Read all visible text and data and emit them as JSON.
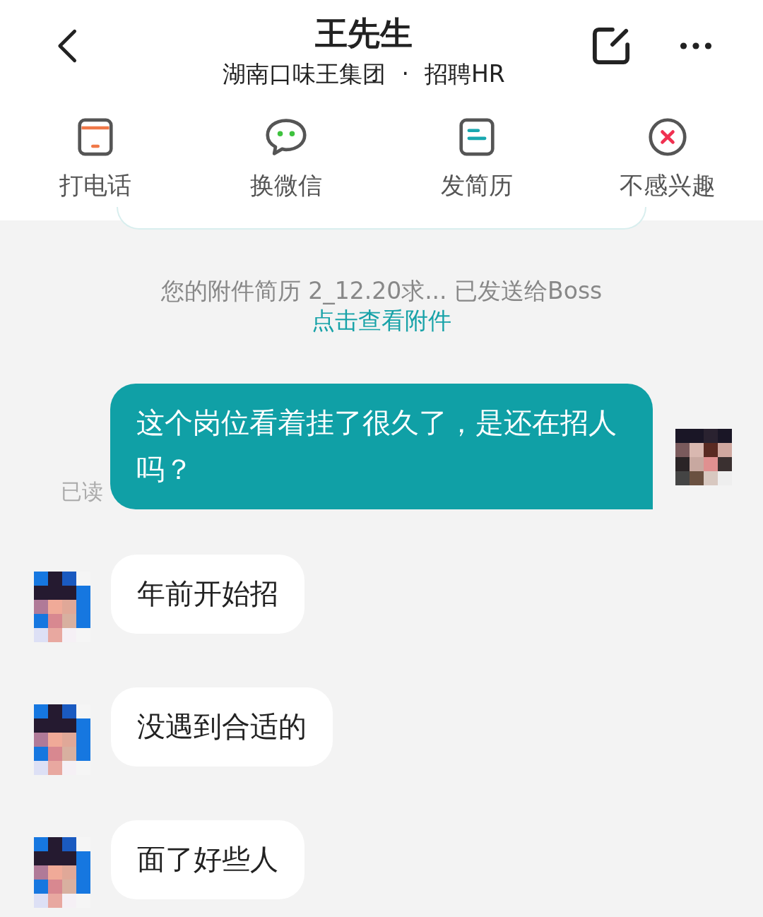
{
  "header": {
    "title": "王先生",
    "company": "湖南口味王集团",
    "separator": "·",
    "role": "招聘HR"
  },
  "actions": [
    {
      "kind": "phone",
      "label": "打电话"
    },
    {
      "kind": "wechat",
      "label": "换微信"
    },
    {
      "kind": "resume",
      "label": "发简历"
    },
    {
      "kind": "decline",
      "label": "不感兴趣"
    }
  ],
  "notice": {
    "text": "您的附件简历 2_12.20求... 已发送给Boss",
    "link": "点击查看附件"
  },
  "messages": [
    {
      "kind": "sent",
      "text": "这个岗位看着挂了很久了，是还在招人吗？",
      "status": "已读"
    },
    {
      "kind": "received",
      "text": "年前开始招"
    },
    {
      "kind": "received",
      "text": "没遇到合适的"
    },
    {
      "kind": "received",
      "text": "面了好些人"
    }
  ]
}
